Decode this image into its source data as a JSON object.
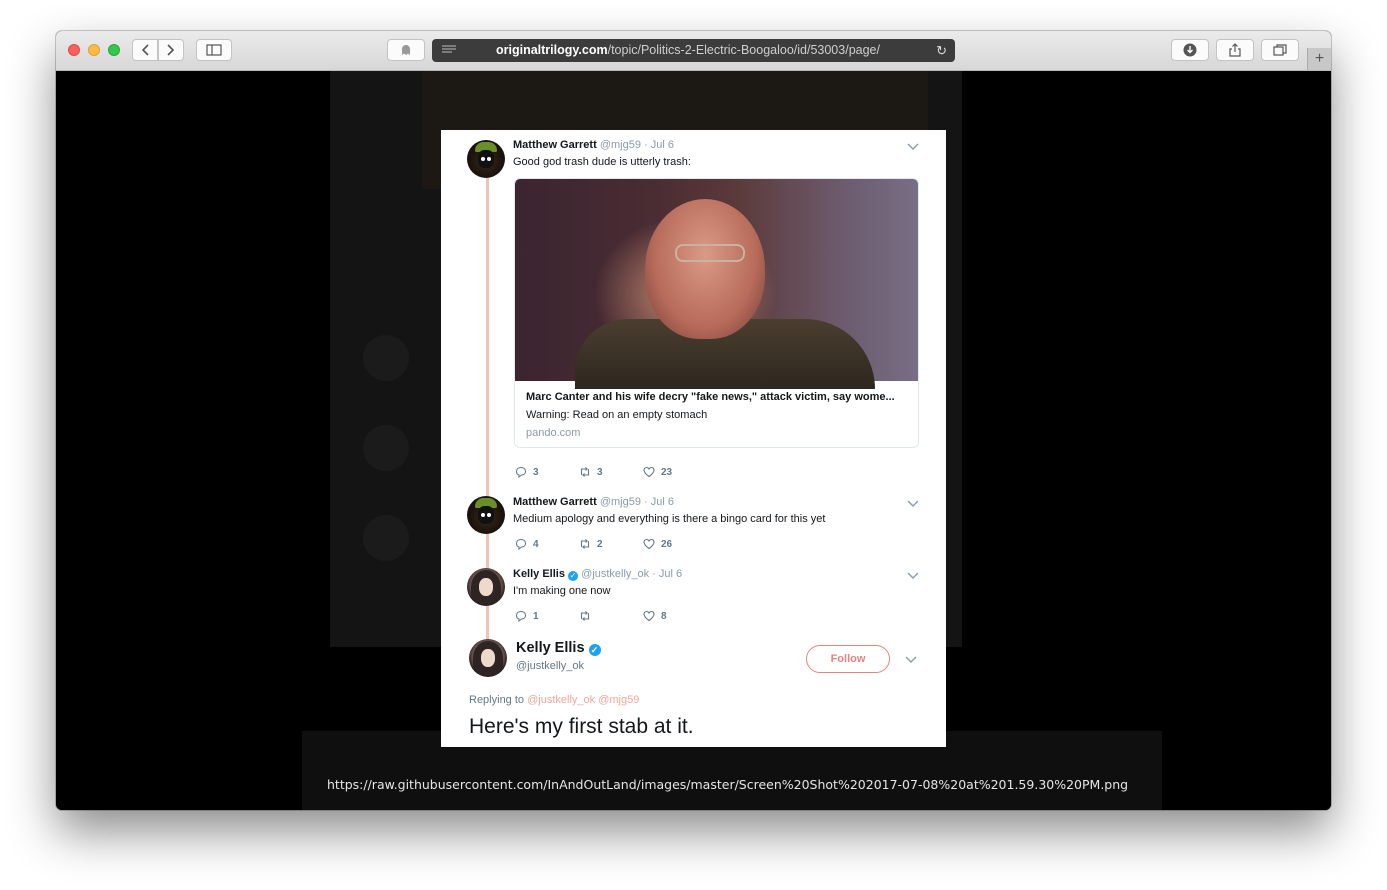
{
  "browser": {
    "url_host": "originaltrilogy.com",
    "url_path": "/topic/Politics-2-Electric-Boogaloo/id/53003/page/",
    "status_url": "https://raw.githubusercontent.com/InAndOutLand/images/master/Screen%20Shot%202017-07-08%20at%201.59.30%20PM.png"
  },
  "tweets": [
    {
      "name": "Matthew Garrett",
      "handle": "@mjg59",
      "date": "· Jul 6",
      "text": "Good god trash dude is utterly trash:",
      "card": {
        "title": "Marc Canter and his wife decry \"fake news,\" attack victim, say wome...",
        "description": "Warning: Read on an empty stomach",
        "domain": "pando.com"
      },
      "replies": "3",
      "retweets": "3",
      "likes": "23"
    },
    {
      "name": "Matthew Garrett",
      "handle": "@mjg59",
      "date": "· Jul 6",
      "text": "Medium apology and everything is there a bingo card for this yet",
      "replies": "4",
      "retweets": "2",
      "likes": "26"
    },
    {
      "name": "Kelly Ellis",
      "handle": "@justkelly_ok",
      "date": "· Jul 6",
      "text": "I'm making one now",
      "replies": "1",
      "retweets": "",
      "likes": "8"
    }
  ],
  "main_tweet": {
    "name": "Kelly Ellis",
    "handle": "@justkelly_ok",
    "follow_label": "Follow",
    "replying_prefix": "Replying to",
    "replying_to": "@justkelly_ok @mjg59",
    "text": "Here's my first stab at it."
  },
  "colors": {
    "accent": "#1da1f2",
    "thread_line": "#f0c2b3",
    "follow": "#e0867f"
  }
}
